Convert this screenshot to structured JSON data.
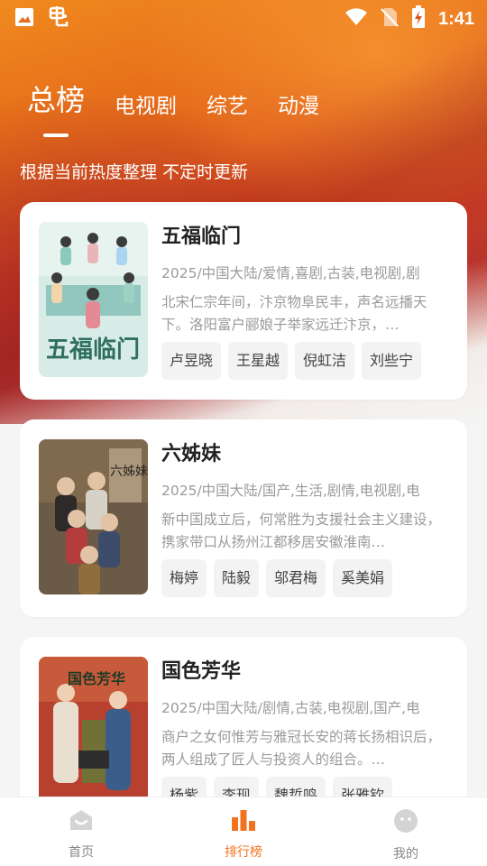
{
  "status_bar": {
    "time": "1:41",
    "app_icon": "bug-icon",
    "left_icons": [
      "image-icon",
      "bug-icon"
    ],
    "right_icons": [
      "wifi-icon",
      "no-sim-icon",
      "battery-charging-icon"
    ]
  },
  "tabs": [
    {
      "label": "总榜",
      "active": true
    },
    {
      "label": "电视剧",
      "active": false
    },
    {
      "label": "综艺",
      "active": false
    },
    {
      "label": "动漫",
      "active": false
    }
  ],
  "subtitle": "根据当前热度整理 不定时更新",
  "items": [
    {
      "title": "五福临门",
      "meta": "2025/中国大陆/爱情,喜剧,古装,电视剧,剧",
      "desc": "北宋仁宗年间，汴京物阜民丰，声名远播天下。洛阳富户郦娘子举家远迁汴京，…",
      "tags": [
        "卢昱晓",
        "王星越",
        "倪虹洁",
        "刘些宁"
      ]
    },
    {
      "title": "六姊妹",
      "meta": "2025/中国大陆/国产,生活,剧情,电视剧,电",
      "desc": "新中国成立后，何常胜为支援社会主义建设，携家带口从扬州江都移居安徽淮南…",
      "tags": [
        "梅婷",
        "陆毅",
        "邬君梅",
        "奚美娟"
      ]
    },
    {
      "title": "国色芳华",
      "meta": "2025/中国大陆/剧情,古装,电视剧,国产,电",
      "desc": "商户之女何惟芳与雅冠长安的蒋长扬相识后，两人组成了匠人与投资人的组合。…",
      "tags": [
        "杨紫",
        "李现",
        "魏哲鸣",
        "张雅钦"
      ]
    }
  ],
  "posters": [
    {
      "text": "五福临门"
    },
    {
      "text": "六姊妹"
    },
    {
      "text": "国色芳华"
    }
  ],
  "nav": [
    {
      "label": "首页",
      "icon": "home-icon",
      "active": false
    },
    {
      "label": "排行榜",
      "icon": "bar-chart-icon",
      "active": true
    },
    {
      "label": "我的",
      "icon": "smiley-face-icon",
      "active": false
    }
  ],
  "colors": {
    "accent": "#f2731f",
    "hero_orange": "#f08a1e",
    "hero_red": "#c03a2a"
  }
}
